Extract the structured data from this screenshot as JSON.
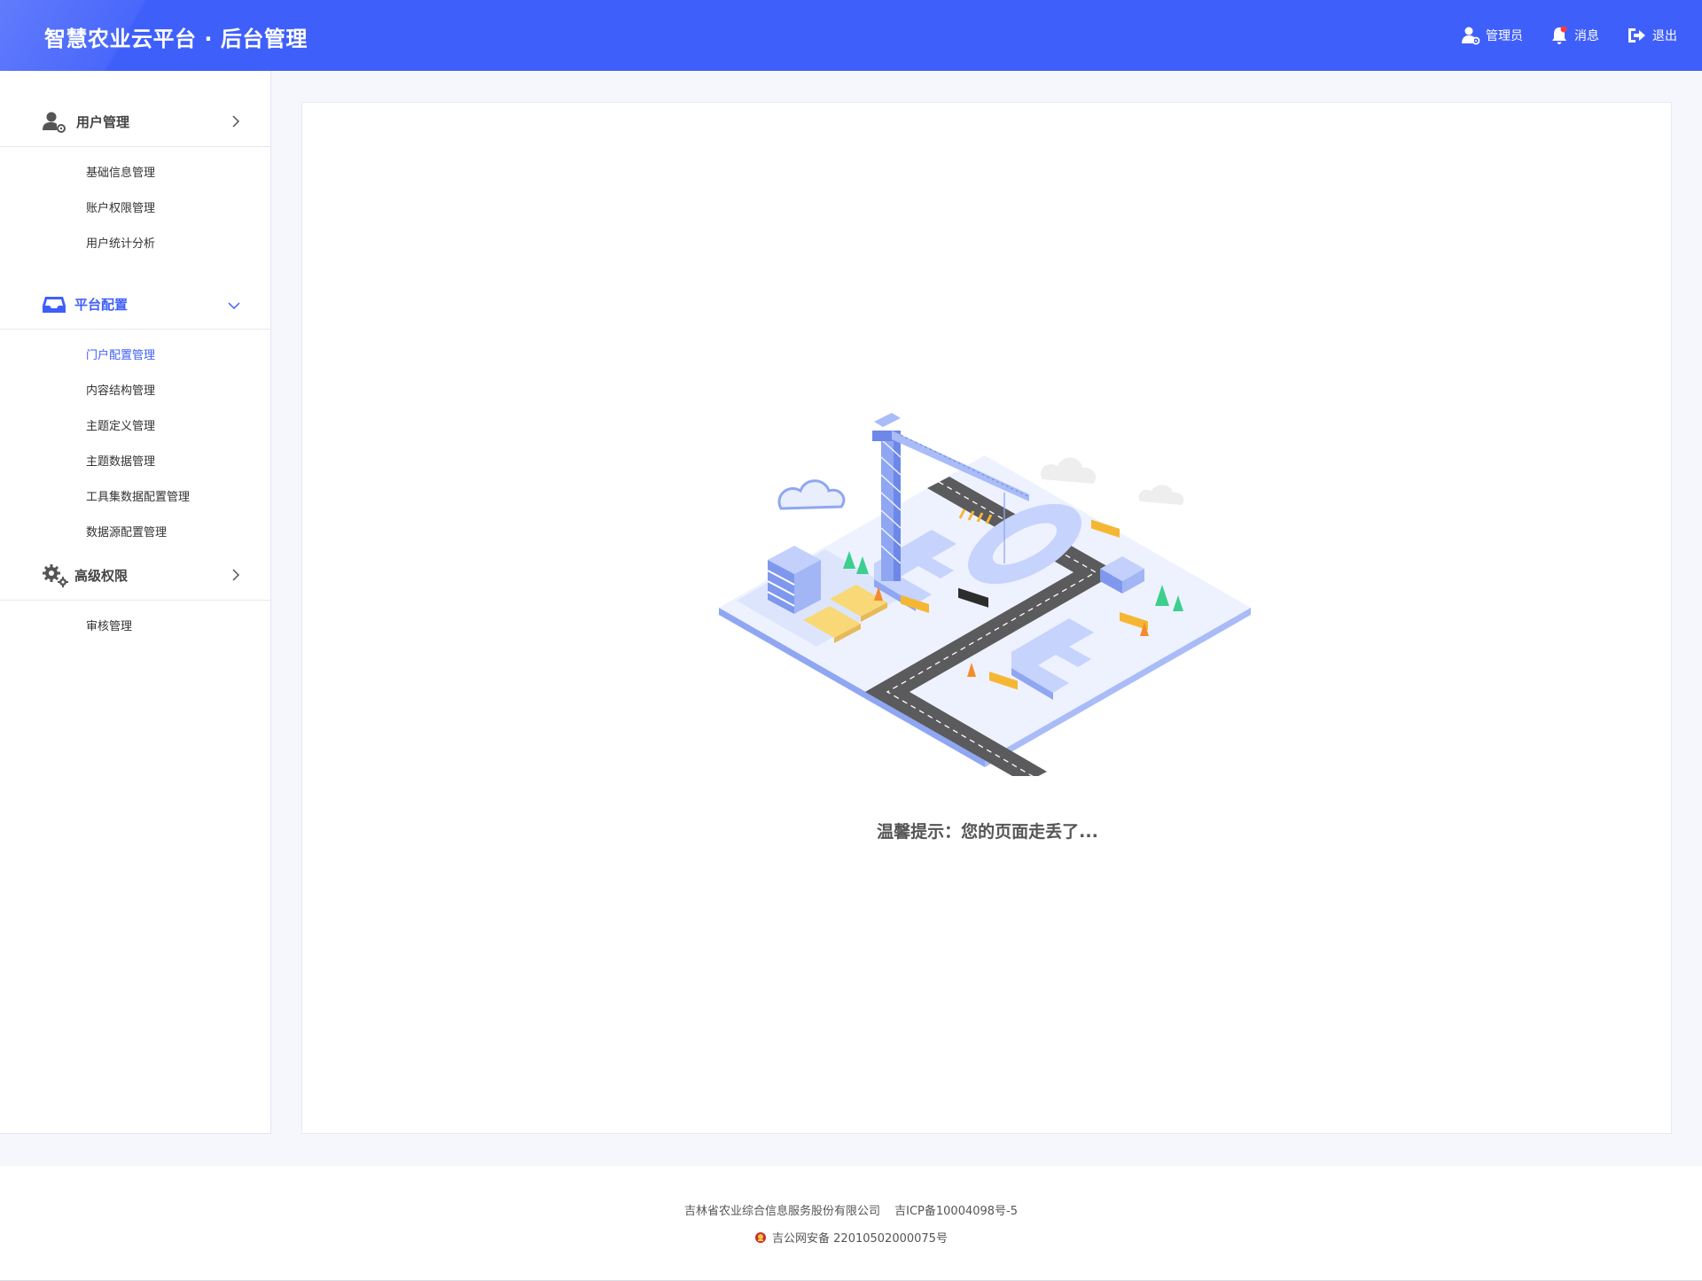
{
  "header": {
    "title": "智慧农业云平台 · 后台管理",
    "admin_label": "管理员",
    "messages_label": "消息",
    "logout_label": "退出",
    "brand_color": "#3f5ffb"
  },
  "sidebar": {
    "groups": [
      {
        "label": "用户管理",
        "icon": "user-gear-icon",
        "expanded": false,
        "items": [
          "基础信息管理",
          "账户权限管理",
          "用户统计分析"
        ]
      },
      {
        "label": "平台配置",
        "icon": "inbox-tray-icon",
        "expanded": true,
        "active": true,
        "items": [
          "门户配置管理",
          "内容结构管理",
          "主题定义管理",
          "主题数据管理",
          "工具集数据配置管理",
          "数据源配置管理"
        ],
        "active_item": "门户配置管理"
      },
      {
        "label": "高级权限",
        "icon": "gears-icon",
        "expanded": false,
        "items": [
          "审核管理"
        ]
      }
    ]
  },
  "main": {
    "tip": "温馨提示：您的页面走丢了..."
  },
  "footer": {
    "company": "吉林省农业综合信息服务股份有限公司",
    "icp": "吉ICP备10004098号-5",
    "police": "吉公网安备 22010502000075号"
  }
}
